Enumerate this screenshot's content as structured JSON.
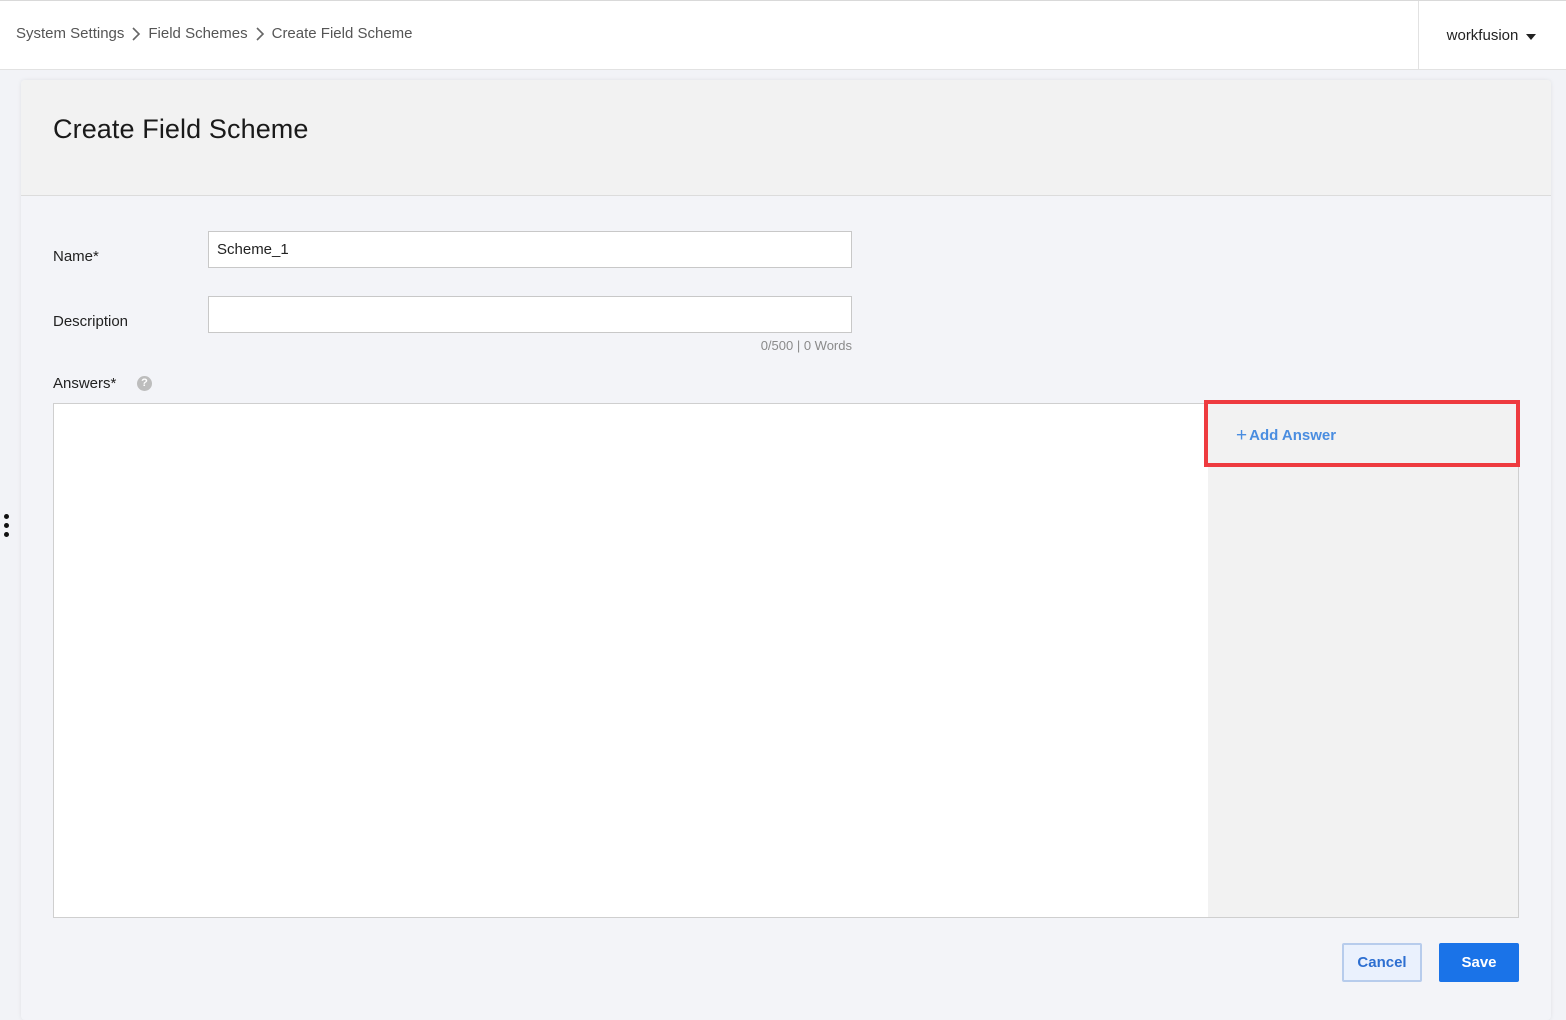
{
  "breadcrumb": {
    "items": [
      "System Settings",
      "Field Schemes",
      "Create Field Scheme"
    ]
  },
  "user_menu": {
    "label": "workfusion"
  },
  "page": {
    "title": "Create Field Scheme"
  },
  "form": {
    "name_label": "Name*",
    "name_value": "Scheme_1",
    "description_label": "Description",
    "description_value": "",
    "description_counter": "0/500 | 0 Words",
    "answers_label": "Answers*",
    "help_glyph": "?",
    "add_answer_label": "Add Answer",
    "add_answer_glyph": "+"
  },
  "actions": {
    "cancel_label": "Cancel",
    "save_label": "Save"
  },
  "colors": {
    "accent": "#1a73e8",
    "link": "#4a8de0",
    "highlight": "#ee3b3f"
  },
  "icons": {
    "breadcrumb_separator": "chevron-right-icon",
    "user_menu_caret": "caret-down-icon",
    "side_handle": "more-vertical-icon",
    "help": "help-circle-icon",
    "add": "plus-icon"
  }
}
